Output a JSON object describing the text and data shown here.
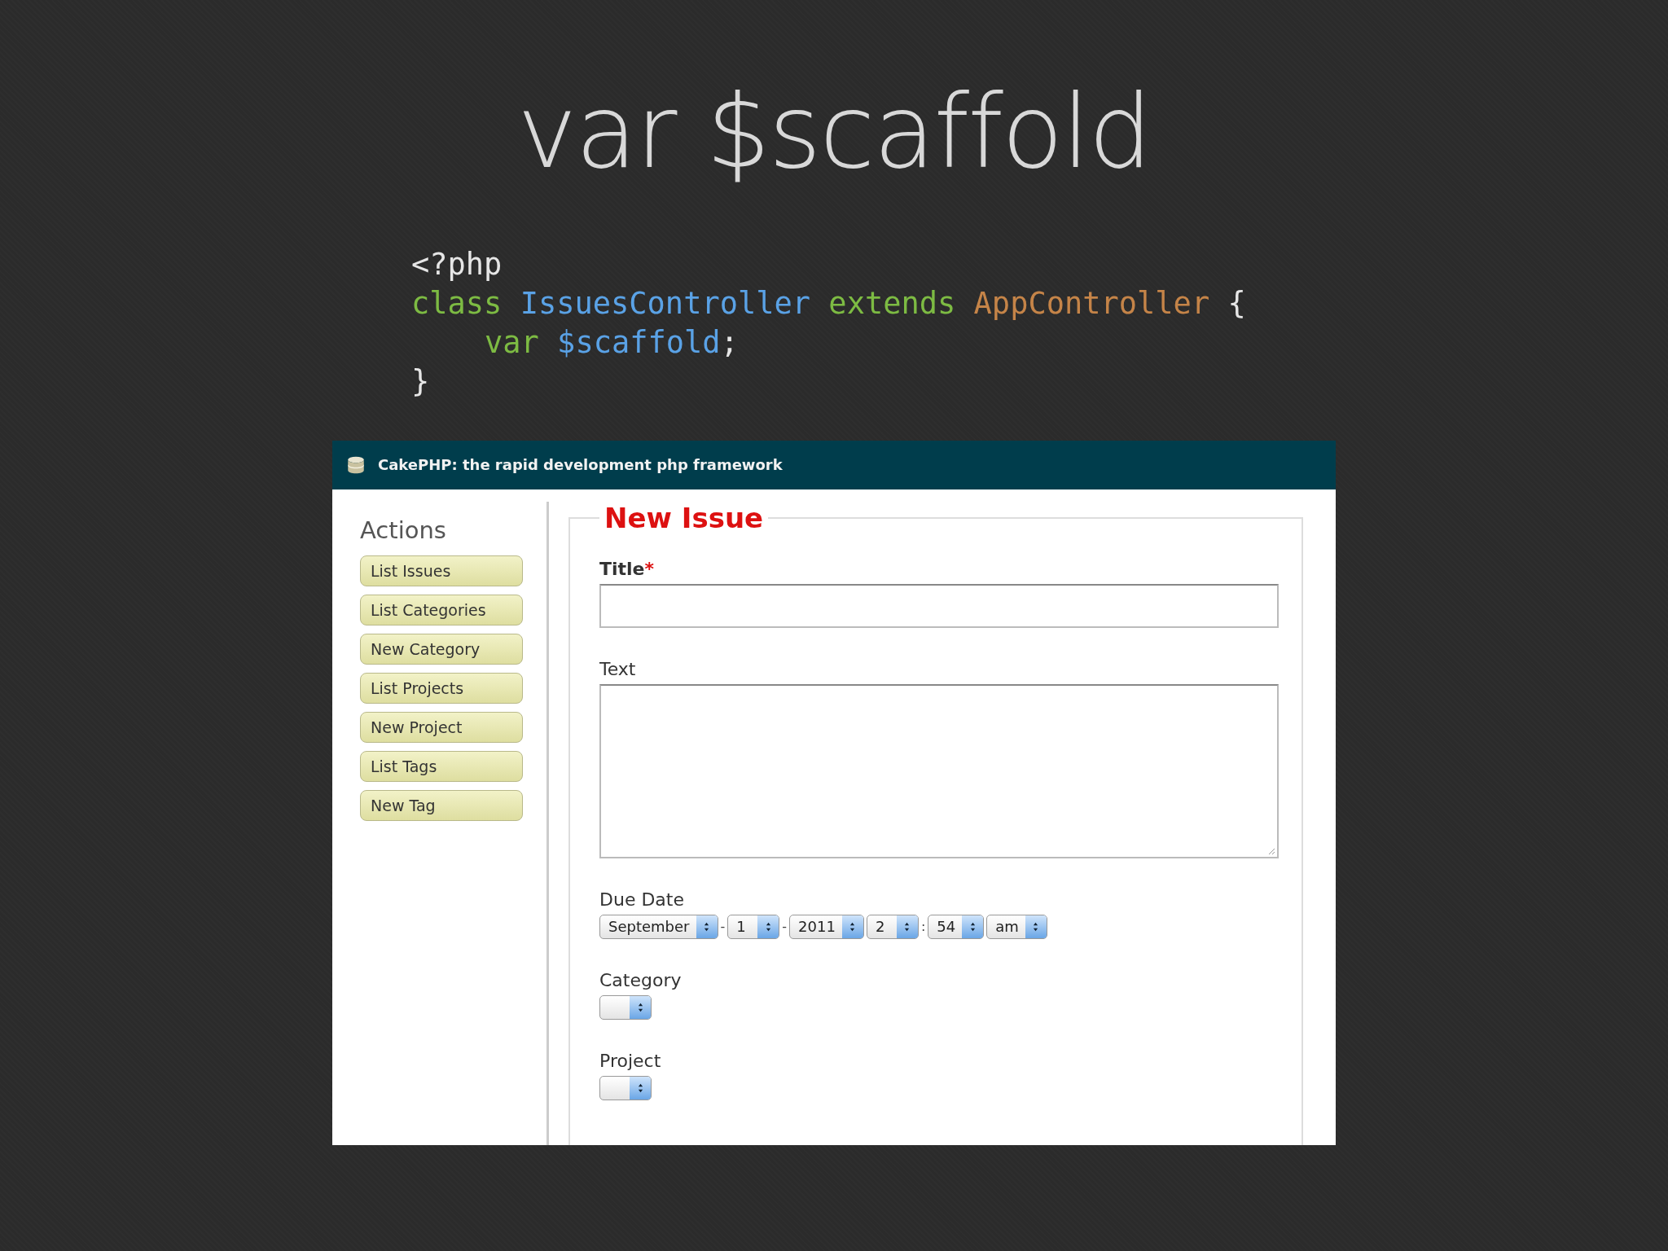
{
  "slide_title": "var $scaffold",
  "code": [
    {
      "indent": false,
      "tokens": [
        {
          "kind": "plain",
          "text": "<?php"
        }
      ]
    },
    {
      "indent": false,
      "tokens": [
        {
          "kind": "keyword",
          "text": "class "
        },
        {
          "kind": "name",
          "text": "IssuesController "
        },
        {
          "kind": "keyword",
          "text": "extends "
        },
        {
          "kind": "parent",
          "text": "AppController "
        },
        {
          "kind": "plain",
          "text": "{"
        }
      ]
    },
    {
      "indent": true,
      "tokens": [
        {
          "kind": "keyword",
          "text": "var "
        },
        {
          "kind": "name",
          "text": "$scaffold"
        },
        {
          "kind": "plain",
          "text": ";"
        }
      ]
    },
    {
      "indent": false,
      "tokens": [
        {
          "kind": "plain",
          "text": "}"
        }
      ]
    }
  ],
  "screenshot": {
    "title": "CakePHP: the rapid development php framework",
    "sidebar": {
      "heading": "Actions",
      "items": [
        "List Issues",
        "List Categories",
        "New Category",
        "List Projects",
        "New Project",
        "List Tags",
        "New Tag"
      ]
    },
    "form": {
      "legend": "New Issue",
      "fields": [
        {
          "kind": "text",
          "label": "Title",
          "required_mark": "*"
        },
        {
          "kind": "textarea",
          "label": "Text"
        },
        {
          "kind": "selects",
          "label": "Due Date",
          "parts": [
            {
              "kind": "select",
              "value": "September"
            },
            {
              "kind": "sep",
              "value": "-"
            },
            {
              "kind": "select",
              "value": "1"
            },
            {
              "kind": "sep",
              "value": "-"
            },
            {
              "kind": "select",
              "value": "2011"
            },
            {
              "kind": "select",
              "value": "2"
            },
            {
              "kind": "sep",
              "value": ":"
            },
            {
              "kind": "select",
              "value": "54"
            },
            {
              "kind": "select",
              "value": "am"
            }
          ]
        },
        {
          "kind": "selects",
          "label": "Category",
          "parts": [
            {
              "kind": "select"
            }
          ]
        },
        {
          "kind": "selects",
          "label": "Project",
          "parts": [
            {
              "kind": "select"
            }
          ]
        }
      ]
    }
  }
}
